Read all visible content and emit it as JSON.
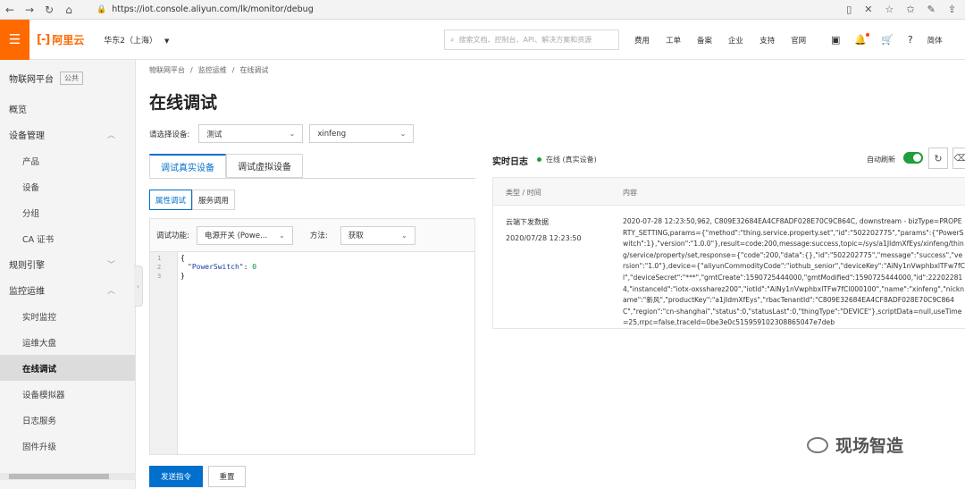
{
  "browser": {
    "url": "https://iot.console.aliyun.com/lk/monitor/debug"
  },
  "topnav": {
    "brand": "阿里云",
    "region": "华东2（上海）",
    "search_placeholder": "搜索文档、控制台、API、解决方案和资源",
    "links": [
      "费用",
      "工单",
      "备案",
      "企业",
      "支持",
      "官网"
    ],
    "lang": "简体"
  },
  "sidebar": {
    "header": "物联网平台",
    "header_badge": "公共",
    "items": [
      {
        "label": "概览"
      },
      {
        "label": "设备管理"
      },
      {
        "label": "产品"
      },
      {
        "label": "设备"
      },
      {
        "label": "分组"
      },
      {
        "label": "CA 证书"
      },
      {
        "label": "规则引擎"
      },
      {
        "label": "监控运维"
      },
      {
        "label": "实时监控"
      },
      {
        "label": "运维大盘"
      },
      {
        "label": "在线调试"
      },
      {
        "label": "设备模拟器"
      },
      {
        "label": "日志服务"
      },
      {
        "label": "固件升级"
      }
    ]
  },
  "breadcrumb": [
    "物联网平台",
    "监控运维",
    "在线调试"
  ],
  "page_title": "在线调试",
  "device_select": {
    "label": "请选择设备:",
    "product": "测试",
    "device": "xinfeng"
  },
  "tabs": [
    "调试真实设备",
    "调试虚拟设备"
  ],
  "subtabs": [
    "属性调试",
    "服务调用"
  ],
  "control": {
    "func_label": "调试功能:",
    "func_value": "电源开关 (Powe...",
    "method_label": "方法:",
    "method_value": "获取"
  },
  "code": {
    "lines": [
      "1",
      "2",
      "3"
    ],
    "open": "{",
    "key": "\"PowerSwitch\"",
    "colon": ": ",
    "value": "0",
    "close": "}"
  },
  "buttons": {
    "send": "发送指令",
    "reset": "重置"
  },
  "log": {
    "title": "实时日志",
    "status": "在线 (真实设备)",
    "auto_refresh": "自动刷新",
    "col_type": "类型 / 时间",
    "col_content": "内容",
    "entry": {
      "type": "云端下发数据",
      "time": "2020/07/28 12:23:50",
      "content": "2020-07-28 12:23:50,962, C809E32684EA4CF8ADF028E70C9C864C, downstream - bizType=PROPERTY_SETTING,params={\"method\":\"thing.service.property.set\",\"id\":\"502202775\",\"params\":{\"PowerSwitch\":1},\"version\":\"1.0.0\"},result=code:200,message:success,topic=/sys/a1JldmXfEys/xinfeng/thing/service/property/set,response={\"code\":200,\"data\":{},\"id\":\"502202775\",\"message\":\"success\",\"version\":\"1.0\"},device={\"aliyunCommodityCode\":\"iothub_senior\",\"deviceKey\":\"AiNy1nVwphbxlTFw7fCl\",\"deviceSecret\":\"***\",\"gmtCreate\":1590725444000,\"gmtModified\":1590725444000,\"id\":222022814,\"instanceId\":\"iotx-oxssharez200\",\"iotId\":\"AiNy1nVwphbxlTFw7fCl000100\",\"name\":\"xinfeng\",\"nickname\":\"新风\",\"productKey\":\"a1JldmXfEys\",\"rbacTenantId\":\"C809E32684EA4CF8ADF028E70C9C864C\",\"region\":\"cn-shanghai\",\"status\":0,\"statusLast\":0,\"thingType\":\"DEVICE\"},scriptData=null,useTime=25,rrpc=false,traceId=0be3e0c515959102308865047e7deb"
    }
  },
  "watermark": "现场智造"
}
